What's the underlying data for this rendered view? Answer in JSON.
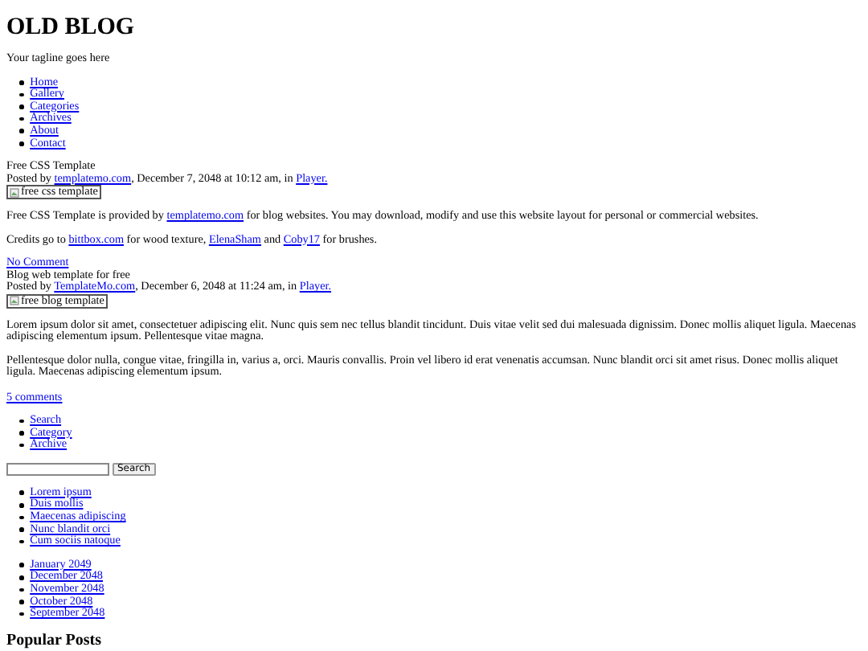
{
  "site": {
    "title": "OLD BLOG",
    "tagline": "Your tagline goes here"
  },
  "nav": [
    "Home",
    "Gallery",
    "Categories",
    "Archives",
    "About",
    "Contact"
  ],
  "posts": [
    {
      "title": "Free CSS Template",
      "byline": [
        {
          "kind": "text",
          "text": "Posted by "
        },
        {
          "kind": "link",
          "text": "templatemo.com"
        },
        {
          "kind": "text",
          "text": ", December 7, 2048 at 10:12 am, in "
        },
        {
          "kind": "link",
          "text": "Player."
        }
      ],
      "image_alt": "free css template",
      "paragraphs": [
        [
          {
            "kind": "text",
            "text": "Free CSS Template is provided by "
          },
          {
            "kind": "link",
            "text": "templatemo.com"
          },
          {
            "kind": "text",
            "text": " for blog websites. You may download, modify and use this website layout for personal or commercial websites."
          }
        ],
        [
          {
            "kind": "text",
            "text": "Credits go to "
          },
          {
            "kind": "link",
            "text": "bittbox.com"
          },
          {
            "kind": "text",
            "text": " for wood texture, "
          },
          {
            "kind": "link",
            "text": "ElenaSham"
          },
          {
            "kind": "text",
            "text": " and "
          },
          {
            "kind": "link",
            "text": "Coby17"
          },
          {
            "kind": "text",
            "text": " for brushes."
          }
        ]
      ],
      "comments": "No Comment"
    },
    {
      "title": "Blog web template for free",
      "byline": [
        {
          "kind": "text",
          "text": "Posted by "
        },
        {
          "kind": "link",
          "text": "TemplateMo.com"
        },
        {
          "kind": "text",
          "text": ", December 6, 2048 at 11:24 am, in "
        },
        {
          "kind": "link",
          "text": "Player."
        }
      ],
      "image_alt": "free blog template",
      "paragraphs": [
        [
          {
            "kind": "text",
            "text": "Lorem ipsum dolor sit amet, consectetuer adipiscing elit. Nunc quis sem nec tellus blandit tincidunt. Duis vitae velit sed dui malesuada dignissim. Donec mollis aliquet ligula. Maecenas adipiscing elementum ipsum. Pellentesque vitae magna."
          }
        ],
        [
          {
            "kind": "text",
            "text": "Pellentesque dolor nulla, congue vitae, fringilla in, varius a, orci. Mauris convallis. Proin vel libero id erat venenatis accumsan. Nunc blandit orci sit amet risus. Donec mollis aliquet ligula. Maecenas adipiscing elementum ipsum."
          }
        ]
      ],
      "comments": "5 comments"
    }
  ],
  "sidebar": {
    "tabs": [
      "Search",
      "Category",
      "Archive"
    ],
    "search": {
      "button": "Search"
    },
    "recent": [
      "Lorem ipsum",
      "Duis mollis",
      "Maecenas adipiscing",
      "Nunc blandit orci",
      "Cum sociis natoque"
    ],
    "archives": [
      "January 2049",
      "December 2048",
      "November 2048",
      "October 2048",
      "September 2048"
    ],
    "popular_heading": "Popular Posts"
  }
}
